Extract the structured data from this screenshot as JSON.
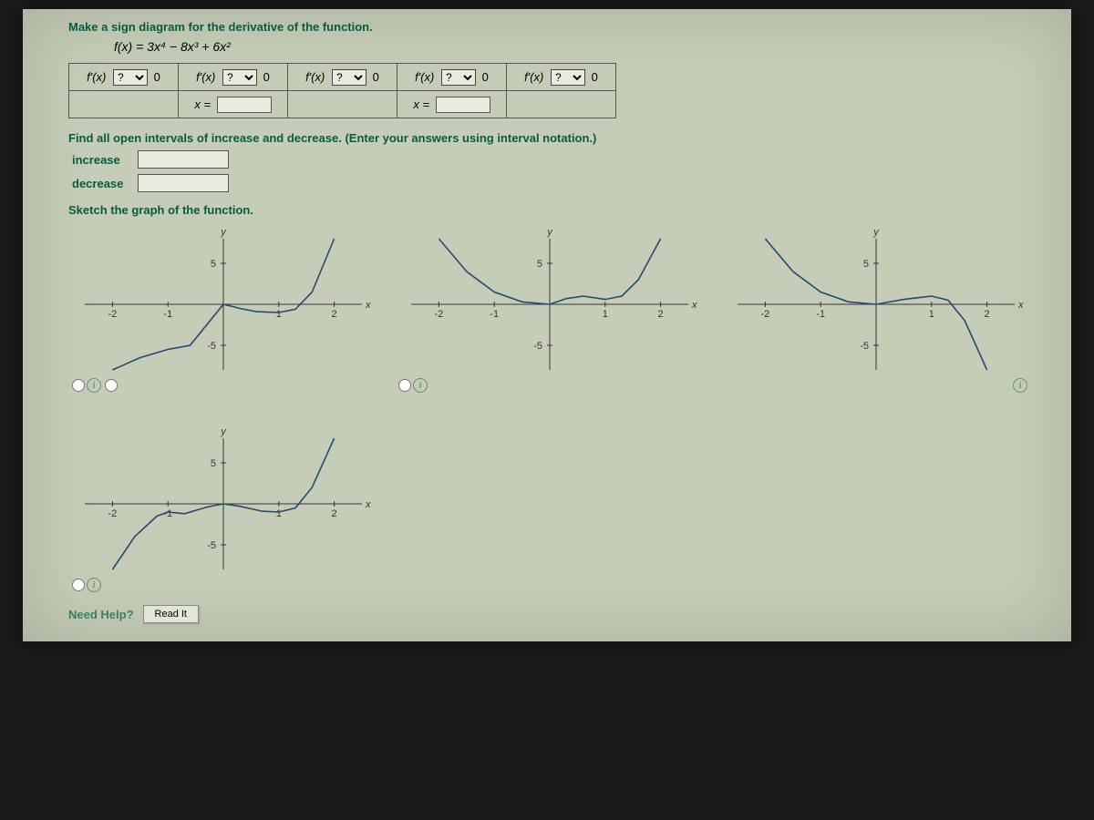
{
  "prompts": {
    "sign_diagram": "Make a sign diagram for the derivative of the function.",
    "find_intervals": "Find all open intervals of increase and decrease. (Enter your answers using interval notation.)",
    "sketch": "Sketch the graph of the function."
  },
  "formula": "f(x) = 3x⁴ − 8x³ + 6x²",
  "sign_table": {
    "fprime_label": "f'(x)",
    "select_placeholder": "?",
    "zero": "0",
    "x_eq": "x ="
  },
  "labels": {
    "increase": "increase",
    "decrease": "decrease",
    "need_help": "Need Help?",
    "read_it": "Read It",
    "y": "y",
    "x": "x"
  },
  "chart_data": [
    {
      "type": "line",
      "xlabel": "x",
      "ylabel": "y",
      "xlim": [
        -2.5,
        2.5
      ],
      "ylim": [
        -8,
        8
      ],
      "xticks": [
        -2,
        -1,
        1,
        2
      ],
      "yticks": [
        -5,
        5
      ],
      "description": "Curve rises from bottom at x≈-2 with local min near x≈-0.6 (y≈-5), local max at x=0 (y=0), dips to another local min near x≈1 (y≈-1), then rises off top at x≈2.",
      "series": [
        {
          "name": "f",
          "x": [
            -2.0,
            -1.5,
            -1.0,
            -0.6,
            -0.3,
            0,
            0.3,
            0.6,
            1.0,
            1.3,
            1.6,
            2.0
          ],
          "y": [
            -8,
            -6.5,
            -5.5,
            -5,
            -2.5,
            0,
            -0.5,
            -0.9,
            -1,
            -0.6,
            1.5,
            8
          ]
        }
      ]
    },
    {
      "type": "line",
      "xlabel": "x",
      "ylabel": "y",
      "xlim": [
        -2.5,
        2.5
      ],
      "ylim": [
        -8,
        8
      ],
      "xticks": [
        -2,
        -1,
        1,
        2
      ],
      "yticks": [
        -5,
        5
      ],
      "description": "Curve falls from top at x≈-2 to local min at x=0 (y=0), slight rise to local max near x≈0.5 (y≈1), dips to min near x≈1 (y≈0.5), then rises off top at x≈2.",
      "series": [
        {
          "name": "f",
          "x": [
            -2.0,
            -1.5,
            -1.0,
            -0.5,
            0,
            0.3,
            0.6,
            1.0,
            1.3,
            1.6,
            2.0
          ],
          "y": [
            8,
            4,
            1.5,
            0.3,
            0,
            0.7,
            1.0,
            0.6,
            1.0,
            3,
            8
          ]
        }
      ]
    },
    {
      "type": "line",
      "xlabel": "x",
      "ylabel": "y",
      "xlim": [
        -2.5,
        2.5
      ],
      "ylim": [
        -8,
        8
      ],
      "xticks": [
        -2,
        -1,
        1,
        2
      ],
      "yticks": [
        -5,
        5
      ],
      "description": "Curve falls from top at x≈-2 to local min at x=0 (y=0), rises to local max near x≈1 (y≈1), then falls off bottom at x≈2.",
      "series": [
        {
          "name": "f",
          "x": [
            -2.0,
            -1.5,
            -1.0,
            -0.5,
            0,
            0.5,
            1.0,
            1.3,
            1.6,
            2.0
          ],
          "y": [
            8,
            4,
            1.5,
            0.3,
            0,
            0.6,
            1.0,
            0.5,
            -2,
            -8
          ]
        }
      ]
    },
    {
      "type": "line",
      "xlabel": "x",
      "ylabel": "y",
      "xlim": [
        -2.5,
        2.5
      ],
      "ylim": [
        -8,
        8
      ],
      "xticks": [
        -2,
        -1,
        1,
        2
      ],
      "yticks": [
        -5,
        5
      ],
      "description": "Curve rises from bottom at x≈-2 to a bump at x≈-1 (y≈-1), dips, then rises to local max at x=0 (y=0), falls to min near x≈1 (y≈-1), rises off top at x≈2.",
      "series": [
        {
          "name": "f",
          "x": [
            -2.0,
            -1.6,
            -1.2,
            -1.0,
            -0.7,
            -0.3,
            0,
            0.3,
            0.7,
            1.0,
            1.3,
            1.6,
            2.0
          ],
          "y": [
            -8,
            -4,
            -1.5,
            -1.0,
            -1.2,
            -0.4,
            0,
            -0.3,
            -0.9,
            -1.0,
            -0.5,
            2,
            8
          ]
        }
      ]
    }
  ]
}
